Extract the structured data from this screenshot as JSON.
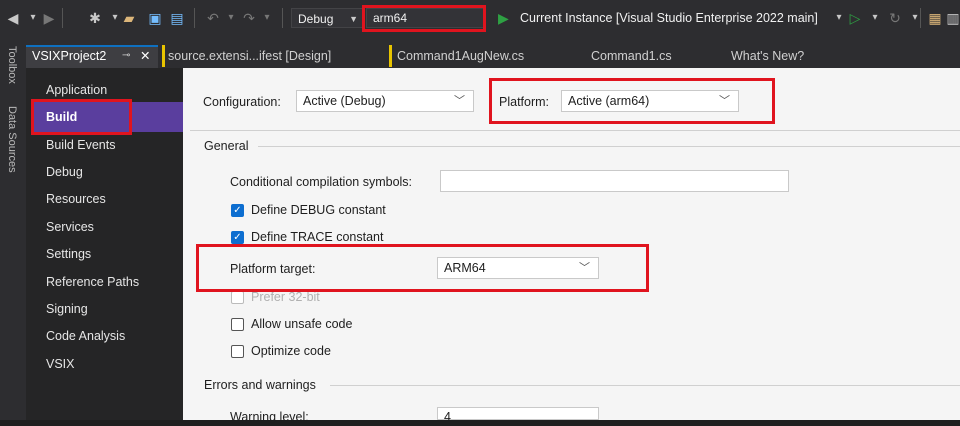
{
  "toolbar": {
    "configuration": "Debug",
    "platform": "arm64",
    "run_label": "Current Instance [Visual Studio Enterprise 2022 main]"
  },
  "tabs": [
    {
      "label": "VSIXProject2",
      "active": true
    },
    {
      "label": "source.extensi...ifest [Design]"
    },
    {
      "label": "Command1AugNew.cs"
    },
    {
      "label": "Command1.cs"
    },
    {
      "label": "What's New?"
    }
  ],
  "side_windows": [
    "Toolbox",
    "Data Sources"
  ],
  "nav": {
    "items": [
      "Application",
      "Build",
      "Build Events",
      "Debug",
      "Resources",
      "Services",
      "Settings",
      "Reference Paths",
      "Signing",
      "Code Analysis",
      "VSIX"
    ],
    "selected": "Build"
  },
  "build": {
    "configuration_label": "Configuration:",
    "configuration_value": "Active (Debug)",
    "platform_label": "Platform:",
    "platform_value": "Active (arm64)",
    "general_header": "General",
    "conditional_symbols_label": "Conditional compilation symbols:",
    "conditional_symbols_value": "",
    "define_debug_label": "Define DEBUG constant",
    "define_trace_label": "Define TRACE constant",
    "platform_target_label": "Platform target:",
    "platform_target_value": "ARM64",
    "prefer32_label": "Prefer 32-bit",
    "unsafe_label": "Allow unsafe code",
    "optimize_label": "Optimize code",
    "errors_header": "Errors and warnings",
    "warning_level_label": "Warning level:",
    "warning_level_value": "4"
  },
  "colors": {
    "highlight": "#e0141e",
    "accent": "#0d6ed0",
    "selection": "#5a3e9e"
  }
}
